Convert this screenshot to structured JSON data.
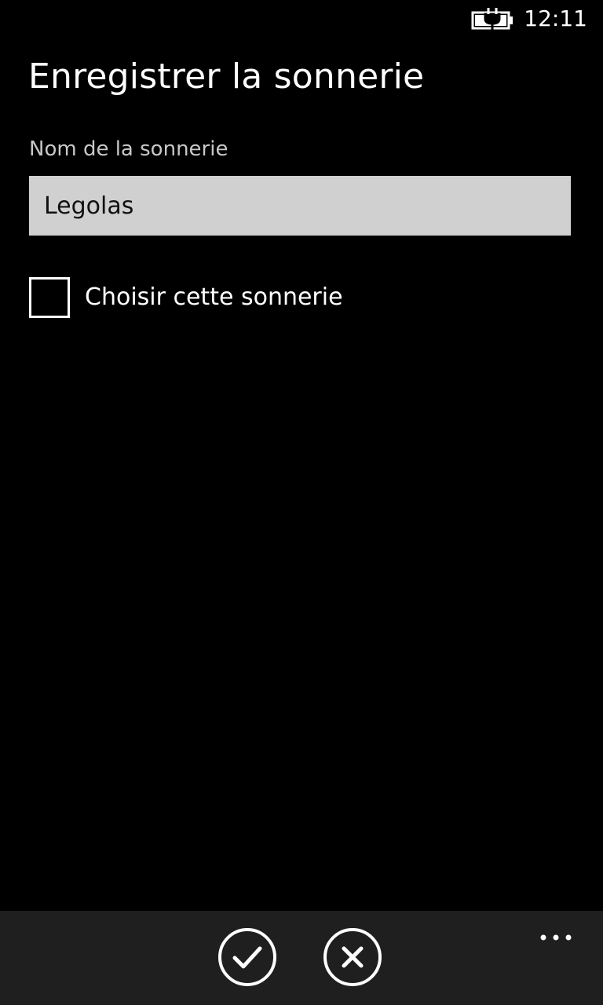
{
  "status_bar": {
    "time": "12:11",
    "battery_icon": "battery-charging-icon"
  },
  "page": {
    "title": "Enregistrer la sonnerie",
    "field_label": "Nom de la sonnerie",
    "ringtone_name_value": "Legolas",
    "checkbox_label": "Choisir cette sonnerie",
    "checkbox_checked": false
  },
  "app_bar": {
    "buttons": [
      {
        "icon": "check-icon"
      },
      {
        "icon": "close-icon"
      }
    ],
    "more_icon": "more-dots-icon",
    "background": "#1f1f1f"
  },
  "colors": {
    "background": "#000000",
    "foreground": "#ffffff",
    "input_background": "#d0d0d0",
    "label": "#c8c8c8"
  }
}
